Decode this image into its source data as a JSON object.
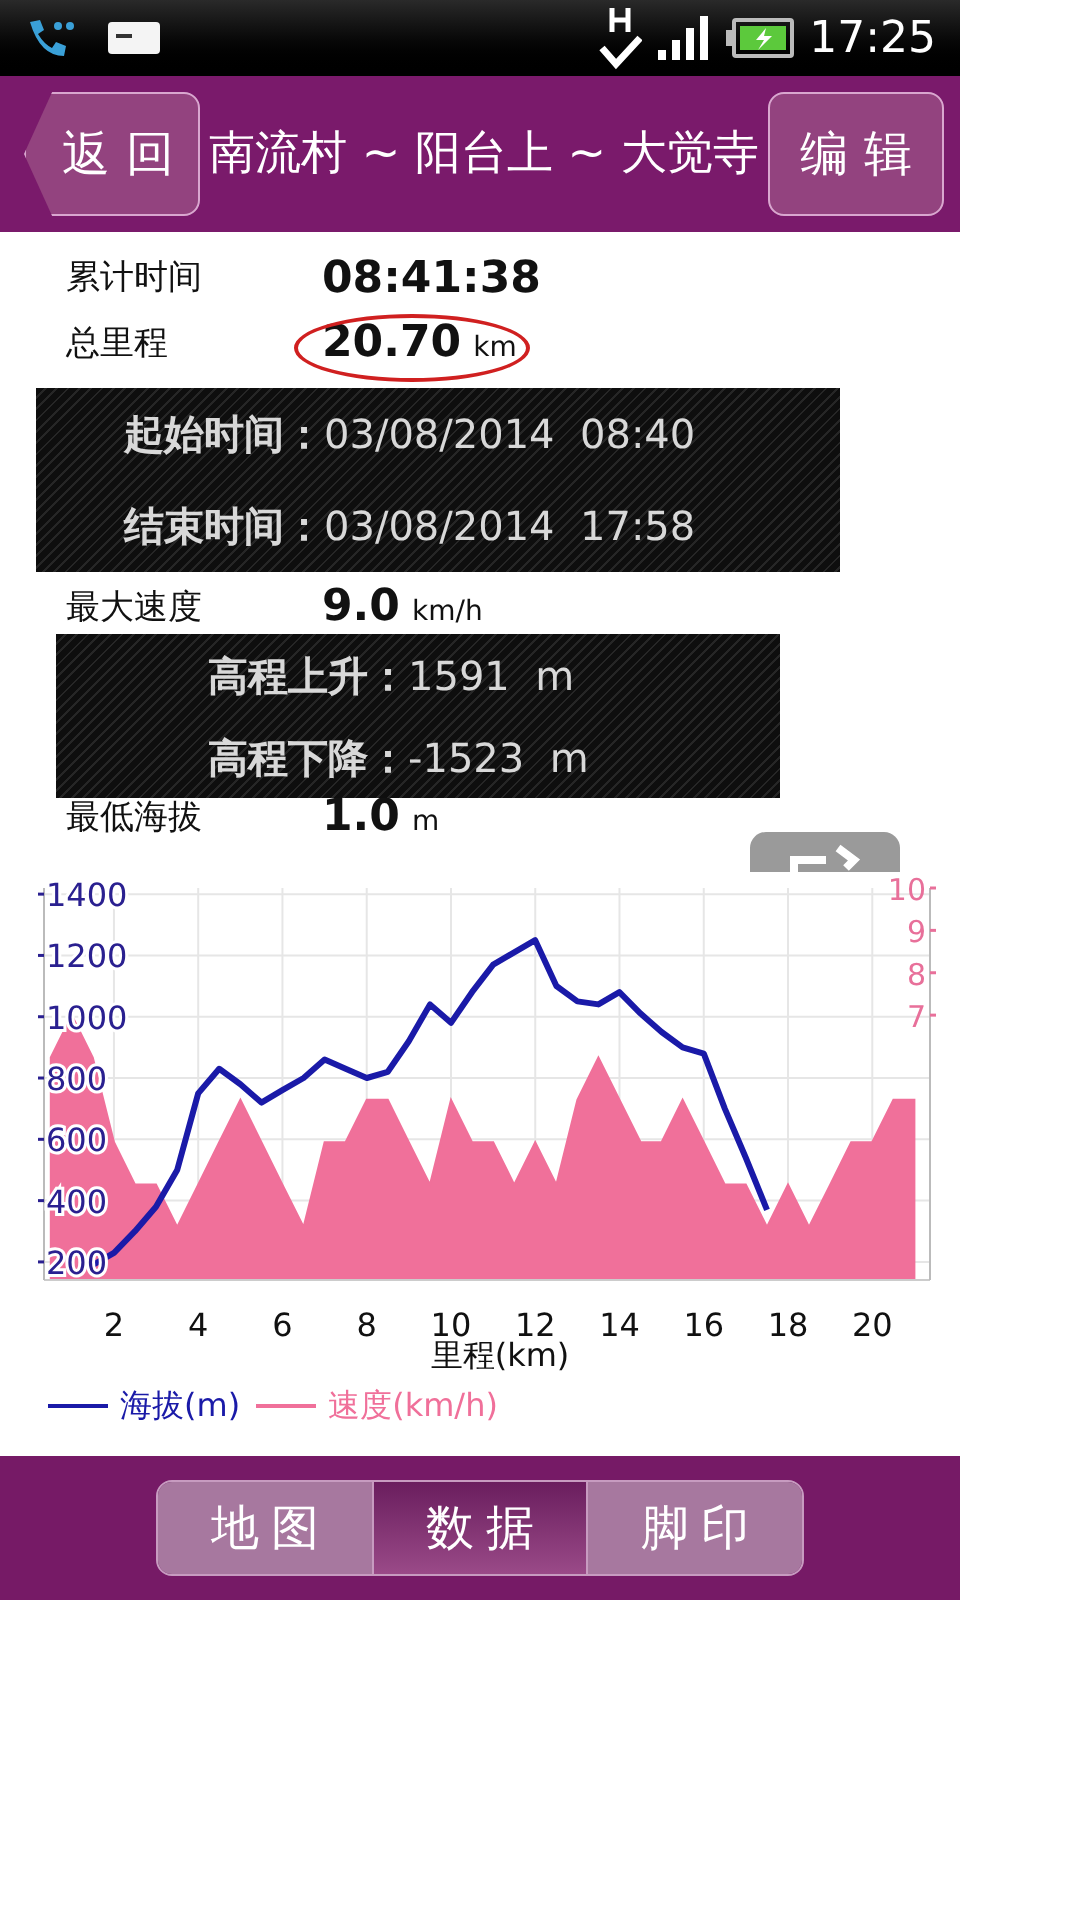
{
  "status_bar": {
    "time": "17:25"
  },
  "header": {
    "back_button": "返回",
    "title": "南流村 ~ 阳台上 ~ 大觉寺",
    "edit_button": "编辑"
  },
  "stats": [
    {
      "label": "累计时间",
      "value": "08:41:38",
      "circled": false
    },
    {
      "label": "总里程",
      "value": "20.70",
      "unit": "km",
      "circled": true
    },
    {
      "label": "最大速度",
      "value": "9.0",
      "unit": "km/h",
      "circled": false
    },
    {
      "label": "最低海拔",
      "value": "1.0",
      "unit": "m",
      "circled": false
    }
  ],
  "overlays": [
    {
      "lines": [
        {
          "label": "起始时间：",
          "value": "03/08/2014  08:40"
        },
        {
          "label": "结束时间：",
          "value": "03/08/2014  17:58"
        }
      ]
    },
    {
      "lines": [
        {
          "label": "高程上升：",
          "value": "1591  m"
        },
        {
          "label": "高程下降：",
          "value": "-1523  m"
        }
      ]
    }
  ],
  "chart": {
    "chart_data": {
      "type": "line",
      "grid": true,
      "legend": true,
      "xlabel": "里程(km)",
      "xlim": [
        0.34,
        21.37
      ],
      "ylim": [
        141,
        1420
      ],
      "y2lim": [
        0.75,
        10
      ],
      "xticks": [
        2,
        4,
        6,
        8,
        10,
        12,
        14,
        16,
        18,
        20
      ],
      "yticks": [
        200,
        400,
        600,
        800,
        1000,
        1200,
        1400
      ],
      "y2ticks": [
        7,
        8,
        9,
        10
      ],
      "x": [
        0.5,
        1,
        1.5,
        2,
        2.5,
        3,
        3.5,
        4,
        4.5,
        5,
        5.5,
        6,
        6.5,
        7,
        7.5,
        8,
        8.5,
        9,
        9.5,
        10,
        10.5,
        11,
        11.5,
        12,
        12.5,
        13,
        13.5,
        14,
        14.5,
        15,
        15.5,
        16,
        16.5,
        17,
        17.5,
        18,
        18.5,
        19,
        19.5,
        20,
        20.5,
        21
      ],
      "series": [
        {
          "name": "海拔(m)",
          "color": "#1a1aa8",
          "values": [
            null,
            null,
            190,
            230,
            300,
            380,
            500,
            750,
            830,
            780,
            720,
            760,
            800,
            860,
            830,
            800,
            820,
            920,
            1040,
            980,
            1080,
            1170,
            1210,
            1250,
            1100,
            1050,
            1040,
            1080,
            1010,
            950,
            900,
            880,
            700,
            540,
            370,
            null,
            null,
            null,
            null,
            null,
            null,
            null
          ]
        },
        {
          "name": "速度(km/h)",
          "color": "#f0709a",
          "type": "area",
          "axis": "y2",
          "values": [
            6,
            7,
            6,
            4,
            3,
            3,
            2,
            3,
            4,
            5,
            4,
            3,
            2,
            4,
            4,
            5,
            5,
            4,
            3,
            5,
            4,
            4,
            3,
            4,
            3,
            5,
            6,
            5,
            4,
            4,
            5,
            4,
            3,
            3,
            2,
            3,
            2,
            3,
            4,
            4,
            5,
            5
          ]
        }
      ]
    }
  },
  "tabs": [
    {
      "label": "地图",
      "selected": false
    },
    {
      "label": "数据",
      "selected": true
    },
    {
      "label": "脚印",
      "selected": false
    }
  ]
}
